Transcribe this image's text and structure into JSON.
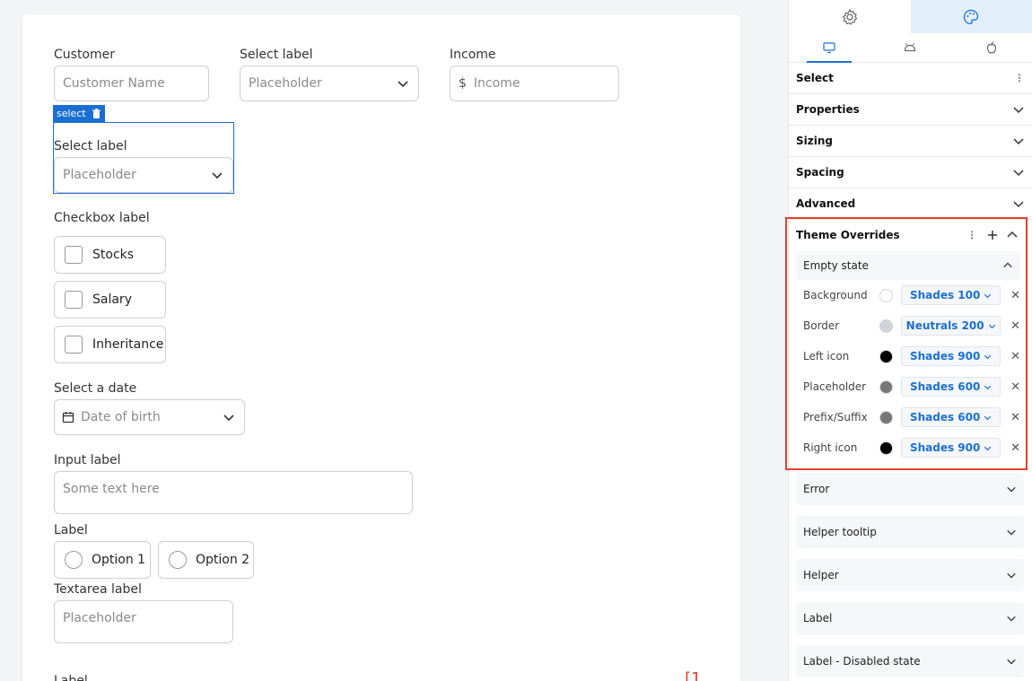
{
  "form": {
    "customer": {
      "label": "Customer",
      "placeholder": "Customer Name"
    },
    "select1": {
      "label": "Select label",
      "placeholder": "Placeholder"
    },
    "income": {
      "label": "Income",
      "prefix": "$",
      "placeholder": "Income"
    },
    "selected_tag": "select",
    "select2": {
      "label": "Select label",
      "placeholder": "Placeholder"
    },
    "checkbox": {
      "label": "Checkbox label",
      "options": [
        "Stocks",
        "Salary",
        "Inheritance"
      ]
    },
    "date": {
      "label": "Select a date",
      "placeholder": "Date of birth"
    },
    "input": {
      "label": "Input label",
      "placeholder": "Some text here"
    },
    "radio": {
      "label": "Label",
      "options": [
        "Option 1",
        "Option 2"
      ]
    },
    "textarea": {
      "label": "Textarea label",
      "placeholder": "Placeholder"
    },
    "bottom_label": "Label",
    "bottom_right": "[1"
  },
  "panel": {
    "sections": [
      "Select",
      "Properties",
      "Sizing",
      "Spacing",
      "Advanced"
    ],
    "overrides": {
      "title": "Theme Overrides",
      "sub": "Empty state",
      "props": [
        {
          "name": "Background",
          "value": "Shades 100",
          "color": "#ffffff"
        },
        {
          "name": "Border",
          "value": "Neutrals 200",
          "color": "#d1d5db"
        },
        {
          "name": "Left icon",
          "value": "Shades 900",
          "color": "#000000"
        },
        {
          "name": "Placeholder",
          "value": "Shades 600",
          "color": "#777777"
        },
        {
          "name": "Prefix/Suffix",
          "value": "Shades 600",
          "color": "#777777"
        },
        {
          "name": "Right icon",
          "value": "Shades 900",
          "color": "#000000"
        }
      ]
    },
    "cards": [
      "Error",
      "Helper tooltip",
      "Helper",
      "Label",
      "Label - Disabled state"
    ]
  },
  "colors": {
    "accent": "#1b6fd1",
    "highlight": "#e2412d"
  }
}
